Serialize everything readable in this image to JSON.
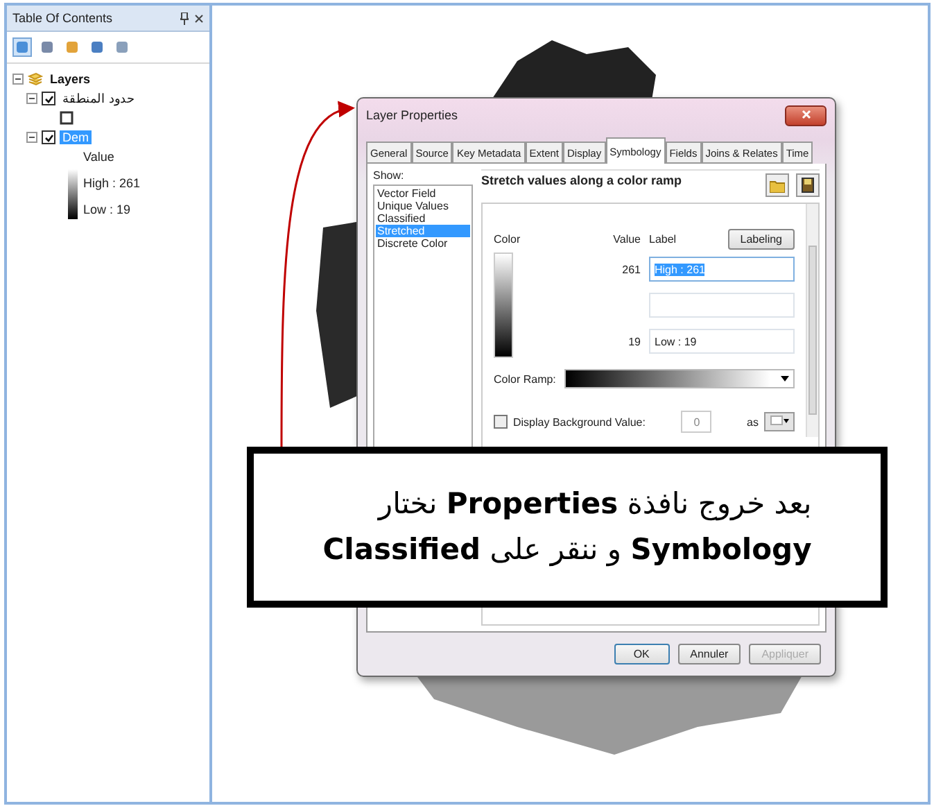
{
  "toc": {
    "title": "Table Of Contents",
    "root": {
      "label": "Layers",
      "expanded": true,
      "children": [
        {
          "kind": "polygon",
          "label": "حدود المنطقة",
          "checked": true,
          "expanded": true,
          "selected": false
        },
        {
          "kind": "raster",
          "label": "Dem",
          "checked": true,
          "expanded": true,
          "selected": true,
          "legend_title": "Value",
          "high": "High : 261",
          "low": "Low : 19"
        }
      ]
    }
  },
  "dialog": {
    "title": "Layer Properties",
    "tabs": [
      {
        "label": "General",
        "selected": false
      },
      {
        "label": "Source",
        "selected": false
      },
      {
        "label": "Key Metadata",
        "selected": false
      },
      {
        "label": "Extent",
        "selected": false
      },
      {
        "label": "Display",
        "selected": false
      },
      {
        "label": "Symbology",
        "selected": true
      },
      {
        "label": "Fields",
        "selected": false
      },
      {
        "label": "Joins & Relates",
        "selected": false
      },
      {
        "label": "Time",
        "selected": false
      }
    ],
    "show_label": "Show:",
    "show_items": [
      {
        "label": "Vector Field",
        "selected": false
      },
      {
        "label": "Unique Values",
        "selected": false
      },
      {
        "label": "Classified",
        "selected": false
      },
      {
        "label": "Stretched",
        "selected": true
      },
      {
        "label": "Discrete Color",
        "selected": false
      }
    ],
    "heading": "Stretch values along a color ramp",
    "columns": [
      "Color",
      "Value",
      "Label"
    ],
    "labeling_button": "Labeling",
    "rows": [
      {
        "value": "261",
        "label": "High : 261",
        "selected": true
      },
      {
        "value": "",
        "label": "",
        "selected": false
      },
      {
        "value": "19",
        "label": "Low : 19",
        "selected": false
      }
    ],
    "color_ramp_label": "Color Ramp:",
    "background": {
      "label": "Display Background Value:",
      "checked": false,
      "value": "0",
      "as_label": "as"
    },
    "buttons": [
      {
        "label": "OK",
        "disabled": false,
        "default": true
      },
      {
        "label": "Annuler",
        "disabled": false,
        "default": false
      },
      {
        "label": "Appliquer",
        "disabled": true,
        "default": false
      }
    ]
  },
  "callout": {
    "lines": [
      "بعد خروج نافذة  **Properties** نختار",
      "**Symbology** و ننقر على  **Classified**"
    ]
  }
}
